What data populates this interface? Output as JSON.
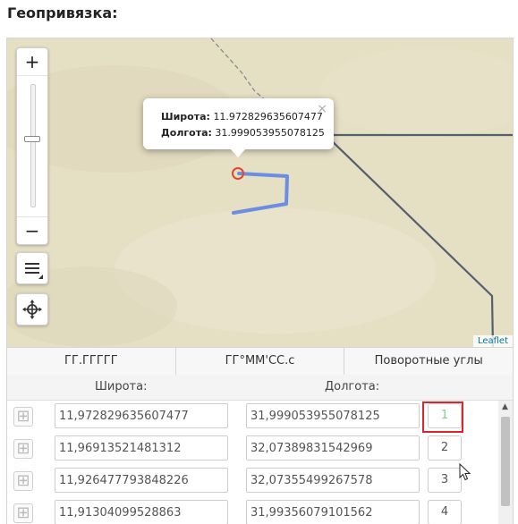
{
  "section_title": "Геопривязка:",
  "map": {
    "zoom_in": "+",
    "zoom_out": "−",
    "attribution": "Leaflet",
    "popup": {
      "lat_label": "Широта:",
      "lat_value": "11.972829635607477",
      "lon_label": "Долгота:",
      "lon_value": "31.999053955078125",
      "close": "×"
    },
    "colors": {
      "route": "#6b8de3",
      "marker": "#e0482c",
      "border_line": "#55606e"
    }
  },
  "tabs": [
    "ГГ.ГГГГГ",
    "ГГ°ММ'СС.с",
    "Поворотные углы"
  ],
  "columns": {
    "latitude": "Широта:",
    "longitude": "Долгота:"
  },
  "points": [
    {
      "lat": "11,972829635607477",
      "lon": "31,999053955078125",
      "num": "1"
    },
    {
      "lat": "11,96913521481312",
      "lon": "32,07389831542969",
      "num": "2"
    },
    {
      "lat": "11,926477793848226",
      "lon": "32,07355499267578",
      "num": "3"
    },
    {
      "lat": "11,91304099528863",
      "lon": "31,99356079101562",
      "num": "4"
    }
  ]
}
